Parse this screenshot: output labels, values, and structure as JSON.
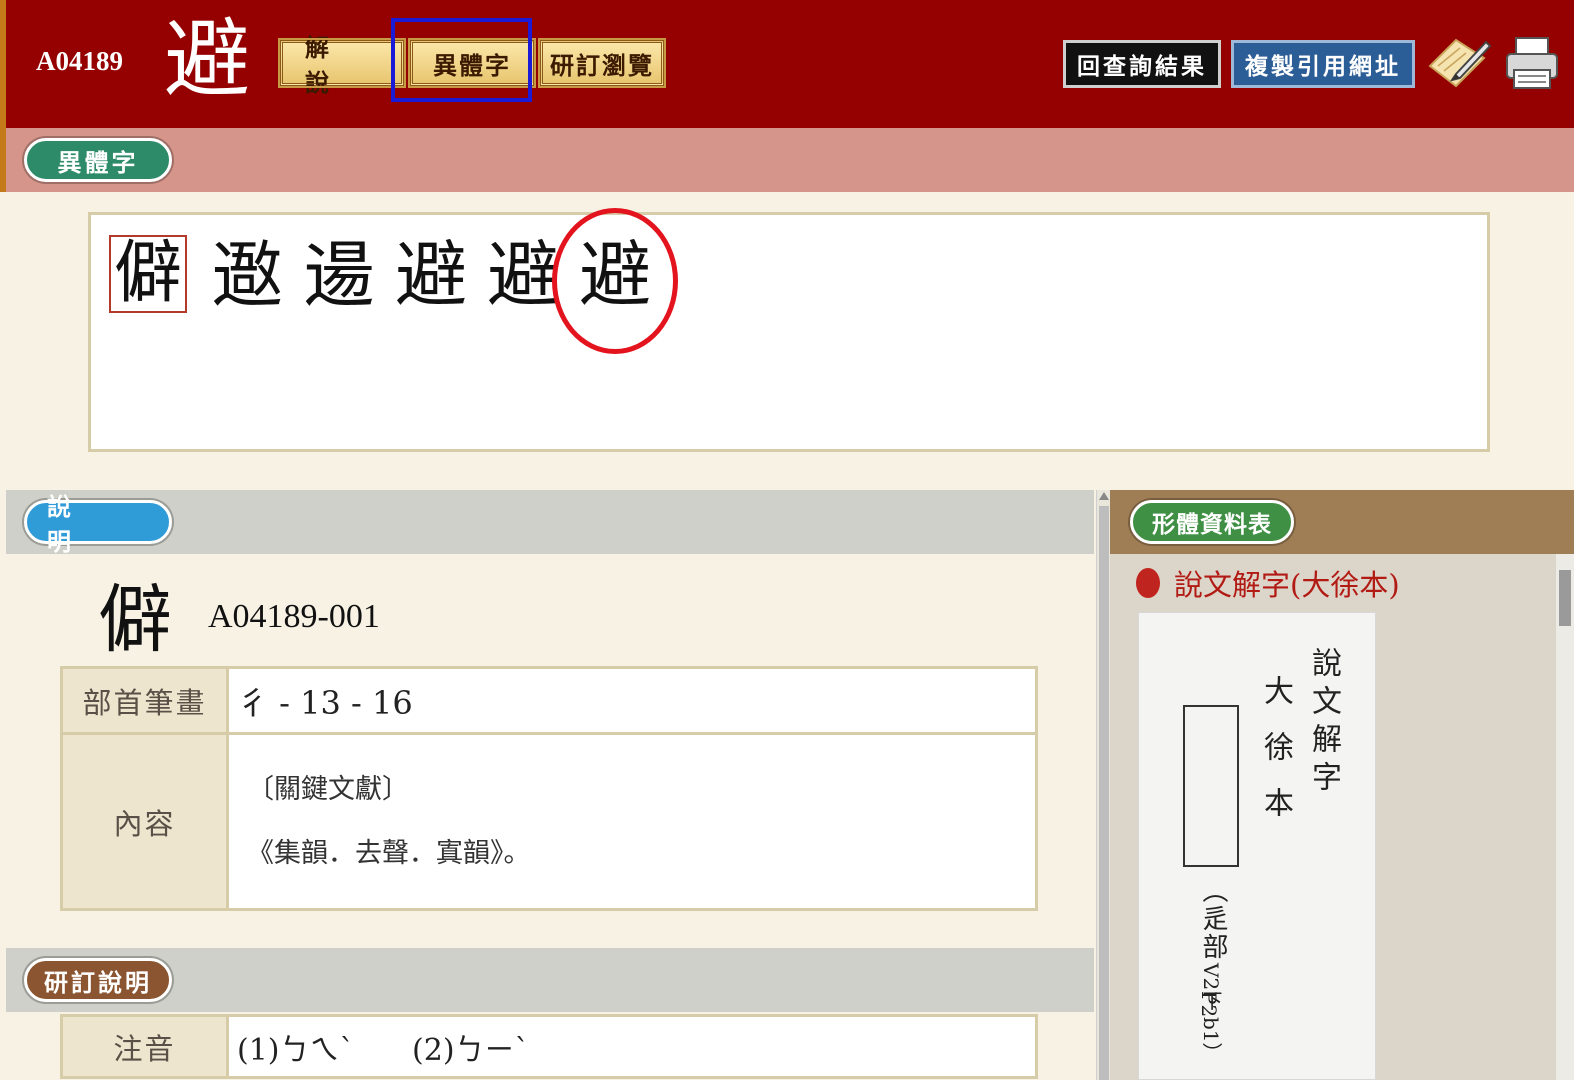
{
  "header": {
    "code": "A04189",
    "main_char": "避",
    "tabs": [
      {
        "label": "解　說"
      },
      {
        "label": "異體字"
      },
      {
        "label": "研訂瀏覽"
      }
    ],
    "back_button": "回查詢結果",
    "copy_button": "複製引用網址"
  },
  "variant_section": {
    "title": "異體字",
    "chars": [
      "僻",
      "䢩",
      "逿",
      "避",
      "避",
      "避"
    ]
  },
  "explain_section": {
    "title": "說　明",
    "variant_char": "僻",
    "variant_code": "A04189-001",
    "radical_label": "部首筆畫",
    "radical_value": "彳 - 13 - 16",
    "content_label": "內容",
    "content_lines": [
      "〔關鍵文獻〕",
      "《集韻．去聲．寘韻》。"
    ]
  },
  "revise_section": {
    "title": "研訂說明",
    "phonetic_label": "注音",
    "phonetic_values": [
      "(1)ㄅㄟˋ",
      "(2)ㄅㄧˋ"
    ]
  },
  "form_section": {
    "title": "形體資料表",
    "source": "說文解字(大徐本)",
    "scan_text": {
      "col1": "說文解字",
      "col2": "大徐本",
      "col3": "（辵部",
      "col4": "V2下",
      "col5": "P2",
      "col6": "b1）"
    }
  }
}
